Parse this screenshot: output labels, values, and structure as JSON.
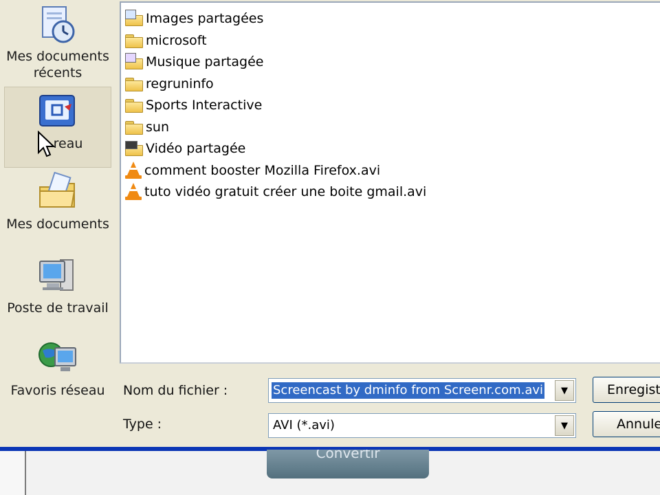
{
  "places": [
    {
      "label_line1": "Mes documents",
      "label_line2": "récents",
      "icon": "recent-documents-icon"
    },
    {
      "label_line1": "reau",
      "label_line2": "",
      "icon": "desktop-icon",
      "selected": true
    },
    {
      "label_line1": "Mes documents",
      "label_line2": "",
      "icon": "my-documents-icon"
    },
    {
      "label_line1": "Poste de travail",
      "label_line2": "",
      "icon": "my-computer-icon"
    },
    {
      "label_line1": "Favoris réseau",
      "label_line2": "",
      "icon": "network-places-icon"
    }
  ],
  "files": [
    {
      "name": "Images partagées",
      "type": "folder-shared"
    },
    {
      "name": "microsoft",
      "type": "folder"
    },
    {
      "name": "Musique partagée",
      "type": "folder-shared"
    },
    {
      "name": "regruninfo",
      "type": "folder"
    },
    {
      "name": "Sports Interactive",
      "type": "folder"
    },
    {
      "name": "sun",
      "type": "folder"
    },
    {
      "name": "Vidéo partagée",
      "type": "folder-video"
    },
    {
      "name": "comment booster Mozilla Firefox.avi",
      "type": "vlc-file"
    },
    {
      "name": "tuto vidéo gratuit créer une boite gmail.avi",
      "type": "vlc-file"
    }
  ],
  "form": {
    "filename_label": "Nom du fichier :",
    "filename_value": "Screencast by dminfo from Screenr.com.avi",
    "type_label": "Type :",
    "type_value": "AVI (*.avi)",
    "save_label": "Enregistr",
    "cancel_label": "Annule"
  },
  "app": {
    "convert_label": "Convertir"
  },
  "colors": {
    "selection": "#316ac5",
    "taskbar_blue": "#0b36b5",
    "vlc_orange": "#f08a12"
  }
}
